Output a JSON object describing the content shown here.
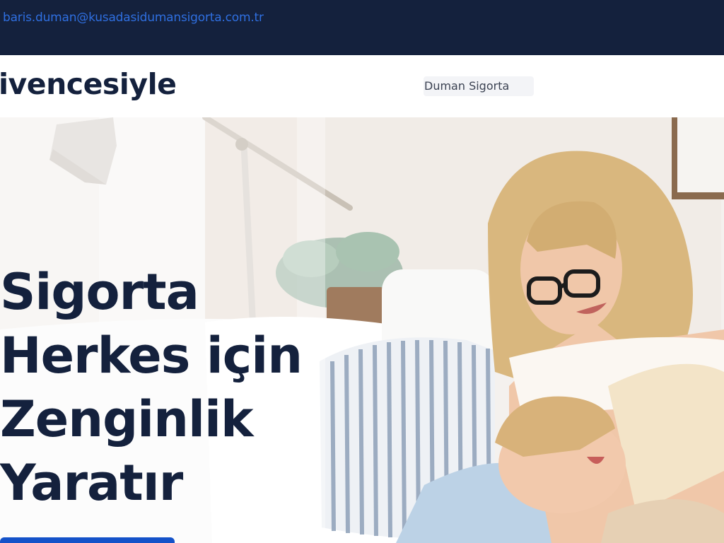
{
  "topbar": {
    "email": "baris.duman@kusadasidumansigorta.com.tr"
  },
  "header": {
    "tagline": "ivencesiyle",
    "brand": "Duman Sigorta"
  },
  "hero": {
    "title_lines": [
      "Sigorta",
      "Herkes için",
      "Zenginlik",
      "Yaratır"
    ],
    "image": "mother-and-child-on-sofa-photo"
  },
  "colors": {
    "topbar_bg": "#14213d",
    "link": "#2f6fe0",
    "heading": "#14213d",
    "cta": "#1452c9"
  }
}
